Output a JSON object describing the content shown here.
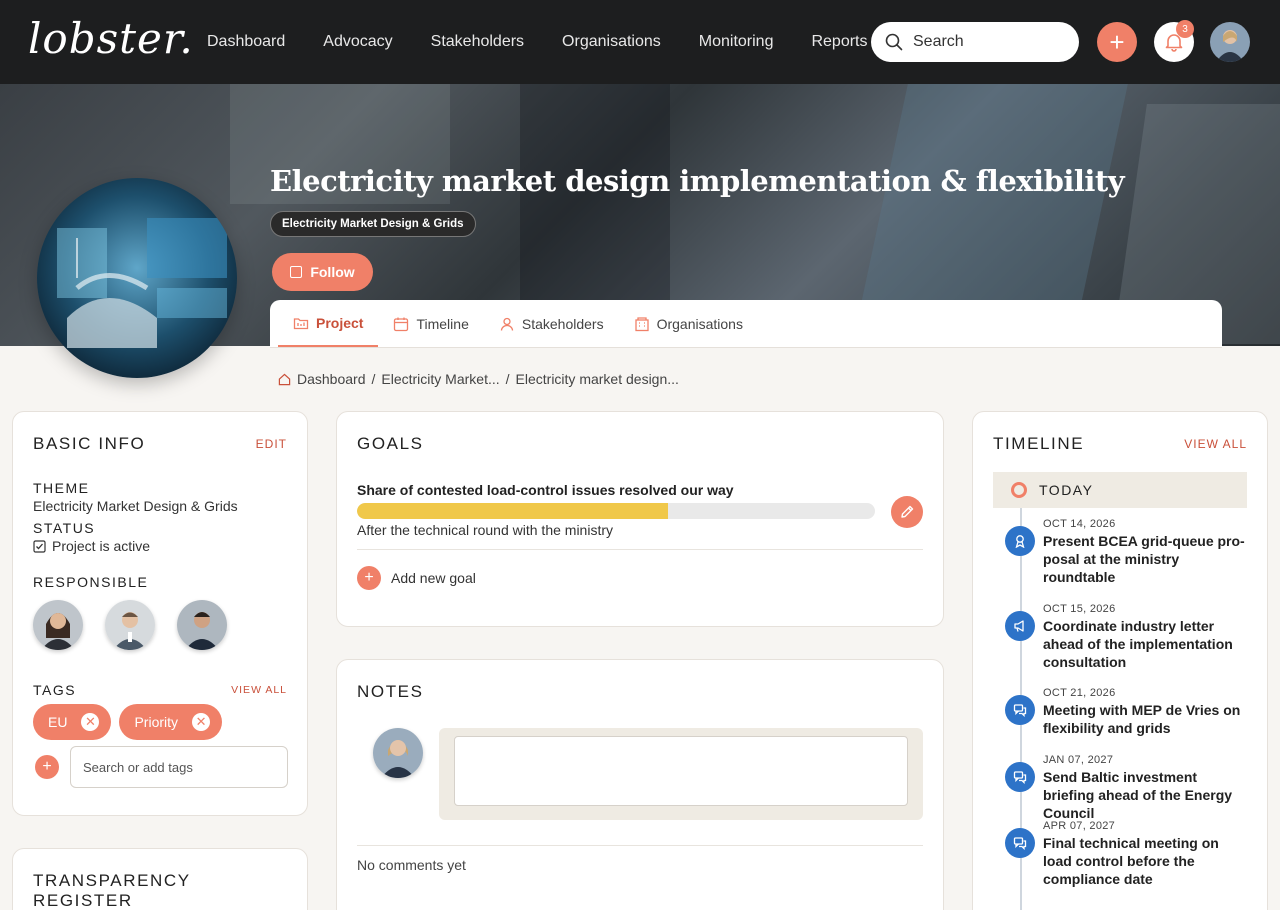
{
  "app": {
    "logo": "lobster."
  },
  "nav": [
    "Dashboard",
    "Advocacy",
    "Stakeholders",
    "Organisations",
    "Monitoring",
    "Reports"
  ],
  "search": {
    "placeholder": "Search"
  },
  "notifications": {
    "count": "3"
  },
  "hero": {
    "title": "Electricity market design implementation & flexibility",
    "chip": "Electricity Market Design & Grids",
    "follow": "Follow"
  },
  "tabs": [
    "Project",
    "Timeline",
    "Stakeholders",
    "Organisations"
  ],
  "breadcrumb": [
    "Dashboard",
    "Electricity Market...",
    "Electricity market design..."
  ],
  "basic_info": {
    "title": "BASIC INFO",
    "edit": "EDIT",
    "theme_label": "THEME",
    "theme": "Electricity Market Design & Grids",
    "status_label": "STATUS",
    "status": "Project is active",
    "responsible_label": "RESPONSIBLE",
    "tags_label": "TAGS",
    "tags_view_all": "VIEW ALL",
    "tags": [
      "EU",
      "Priority"
    ],
    "tag_input_placeholder": "Search or add tags"
  },
  "transparency": {
    "title": "TRANSPARENCY REGISTER"
  },
  "goals": {
    "title": "GOALS",
    "goal_title": "Share of contested load-control issues resolved our way",
    "goal_progress": 0.6,
    "goal_sub": "After the technical round with the ministry",
    "add": "Add new goal"
  },
  "notes": {
    "title": "NOTES",
    "empty": "No comments yet"
  },
  "timeline": {
    "title": "TIMELINE",
    "view_all": "VIEW ALL",
    "today": "TODAY",
    "items": [
      {
        "date": "OCT 14, 2026",
        "text": "Present BCEA grid-queue pro-posal at the ministry roundtable",
        "icon": "ribbon-icon"
      },
      {
        "date": "OCT 15, 2026",
        "text": "Coordinate industry letter ahead of the implementation consultation",
        "icon": "megaphone-icon"
      },
      {
        "date": "OCT 21, 2026",
        "text": "Meeting with MEP de Vries on flexibility and grids",
        "icon": "chat-icon"
      },
      {
        "date": "JAN 07, 2027",
        "text": "Send Baltic investment briefing ahead of the Energy Council",
        "icon": "chat-icon"
      },
      {
        "date": "APR 07, 2027",
        "text": "Final technical meeting on load control before the compliance date",
        "icon": "chat-icon"
      }
    ]
  },
  "colors": {
    "accent": "#f08068",
    "timeline_dot": "#2d73c8",
    "progress": "#f0c84a"
  }
}
